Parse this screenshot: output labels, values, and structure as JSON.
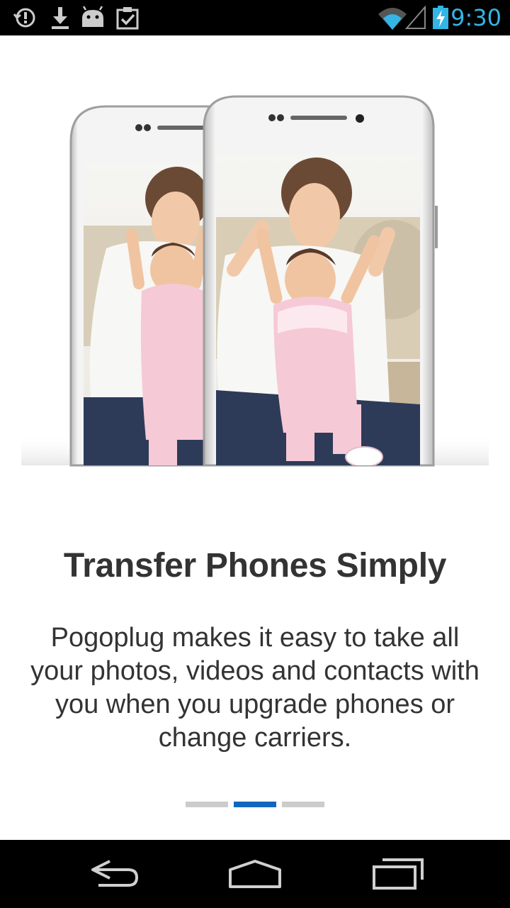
{
  "status_bar": {
    "time": "9:30",
    "icons": [
      "sync-icon",
      "download-icon",
      "android-icon",
      "clipboard-check-icon",
      "wifi-icon",
      "signal-icon",
      "battery-charging-icon"
    ],
    "time_color": "#33b5e5"
  },
  "onboarding": {
    "title": "Transfer Phones Simply",
    "description": "Pogoplug makes it easy to take all your photos, videos and contacts with you when you upgrade phones or change carriers.",
    "pager": {
      "total_pages": 3,
      "current_page": 2,
      "active_color": "#1565c0",
      "inactive_color": "#cccccc"
    }
  },
  "nav_bar": {
    "buttons": [
      "back-icon",
      "home-icon",
      "recent-apps-icon"
    ]
  }
}
